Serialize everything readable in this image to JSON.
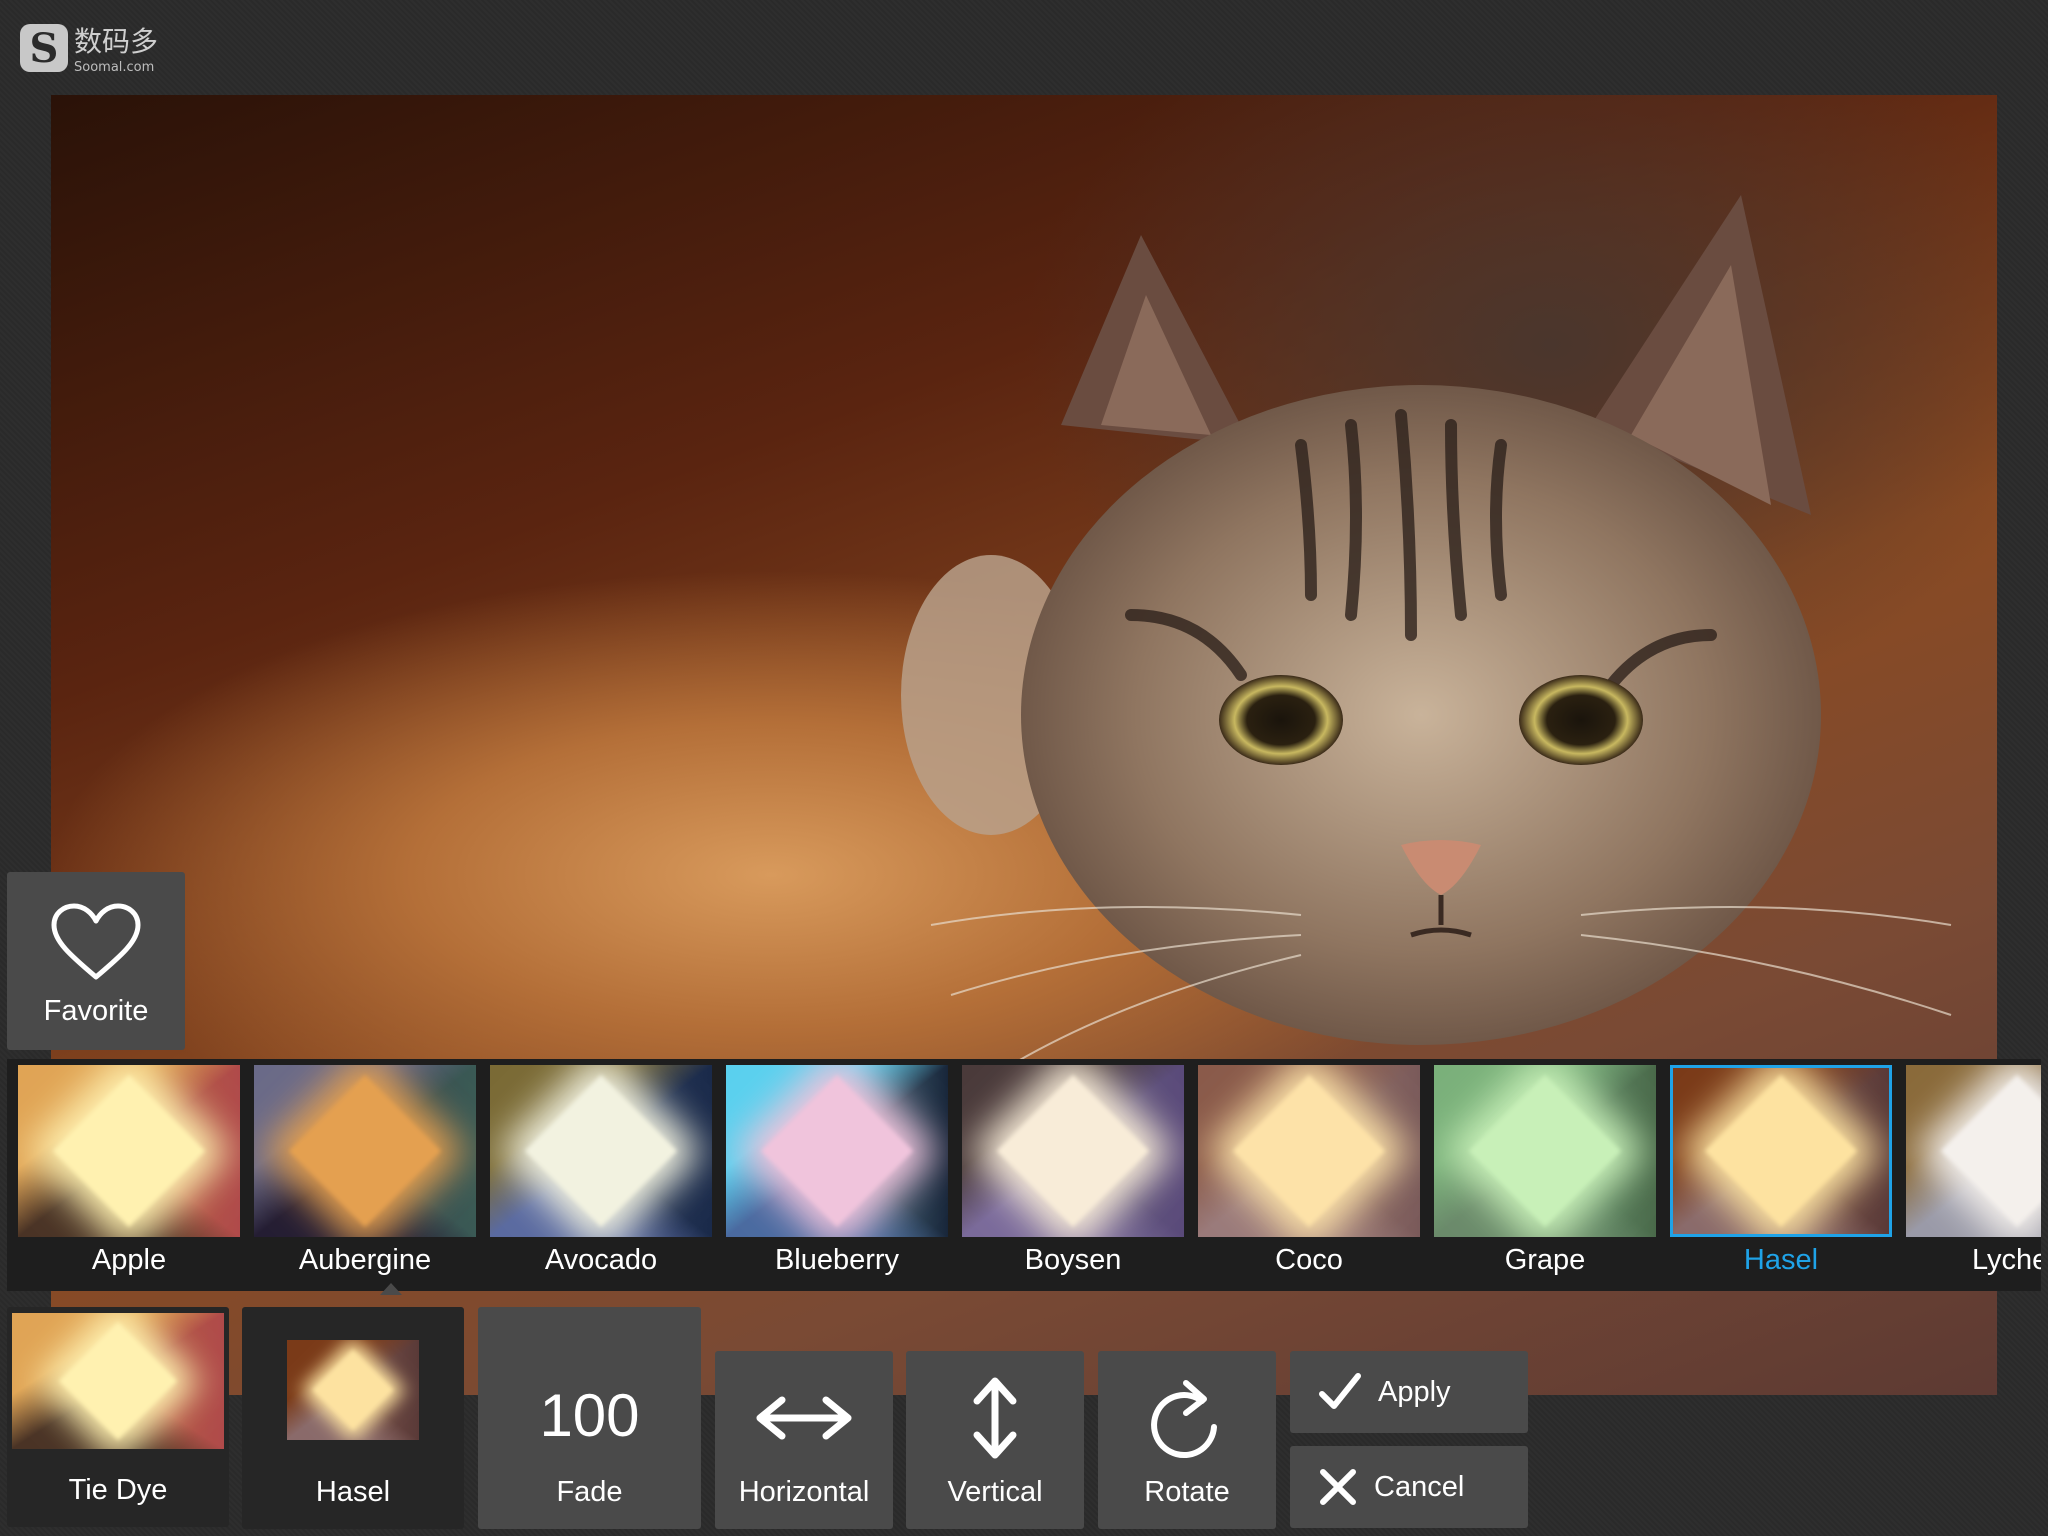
{
  "watermark": {
    "cn": "数码多",
    "en": "Soomal.com"
  },
  "favorite": {
    "label": "Favorite",
    "icon": "heart-icon"
  },
  "filters": [
    {
      "name": "Apple",
      "top": "#e0a455",
      "left": "#b47a35",
      "right": "#b04a4a",
      "bottom": "#4a3325",
      "center": "#fff1b0"
    },
    {
      "name": "Aubergine",
      "top": "#6a6a88",
      "left": "#2e2a44",
      "right": "#3a5a55",
      "bottom": "#241d33",
      "center": "#e4a050"
    },
    {
      "name": "Avocado",
      "top": "#7a6a35",
      "left": "#3a4a6a",
      "right": "#1a2a4a",
      "bottom": "#5a6aa0",
      "center": "#f2f2e0"
    },
    {
      "name": "Blueberry",
      "top": "#5ad0ee",
      "left": "#a0e0f0",
      "right": "#18263a",
      "bottom": "#4a6aa0",
      "center": "#f0c4dc"
    },
    {
      "name": "Boysen",
      "top": "#4a3a3a",
      "left": "#6a6a7a",
      "right": "#5a4a7a",
      "bottom": "#7a6a9a",
      "center": "#f8ecd8"
    },
    {
      "name": "Coco",
      "top": "#8a5a4a",
      "left": "#b08a7a",
      "right": "#7a5a5a",
      "bottom": "#9a7a7a",
      "center": "#fde2a8"
    },
    {
      "name": "Grape",
      "top": "#7ab07a",
      "left": "#8ac09a",
      "right": "#4a6a4a",
      "bottom": "#6a8a6a",
      "center": "#c8f0b8"
    },
    {
      "name": "Hasel",
      "top": "#7a3a18",
      "left": "#9a6a5a",
      "right": "#5a3a38",
      "bottom": "#8a6a6a",
      "center": "#fde2a0"
    },
    {
      "name": "Lyche",
      "top": "#8a6a3a",
      "left": "#7a7a8a",
      "right": "#5a5a6a",
      "bottom": "#9a9aa8",
      "center": "#f4f0ec"
    }
  ],
  "selected_filter": "Hasel",
  "tools": {
    "tie_dye": {
      "label": "Tie Dye"
    },
    "hasel": {
      "label": "Hasel"
    },
    "fade": {
      "value": "100",
      "label": "Fade"
    },
    "horizontal": {
      "label": "Horizontal",
      "icon": "horizontal-arrows-icon"
    },
    "vertical": {
      "label": "Vertical",
      "icon": "vertical-arrows-icon"
    },
    "rotate": {
      "label": "Rotate",
      "icon": "rotate-icon"
    }
  },
  "actions": {
    "apply": {
      "label": "Apply",
      "icon": "check-icon"
    },
    "cancel": {
      "label": "Cancel",
      "icon": "close-icon"
    }
  },
  "colors": {
    "accent": "#1fa3e8",
    "tile": "#4a4a4a",
    "strip": "#1e1e1e"
  }
}
